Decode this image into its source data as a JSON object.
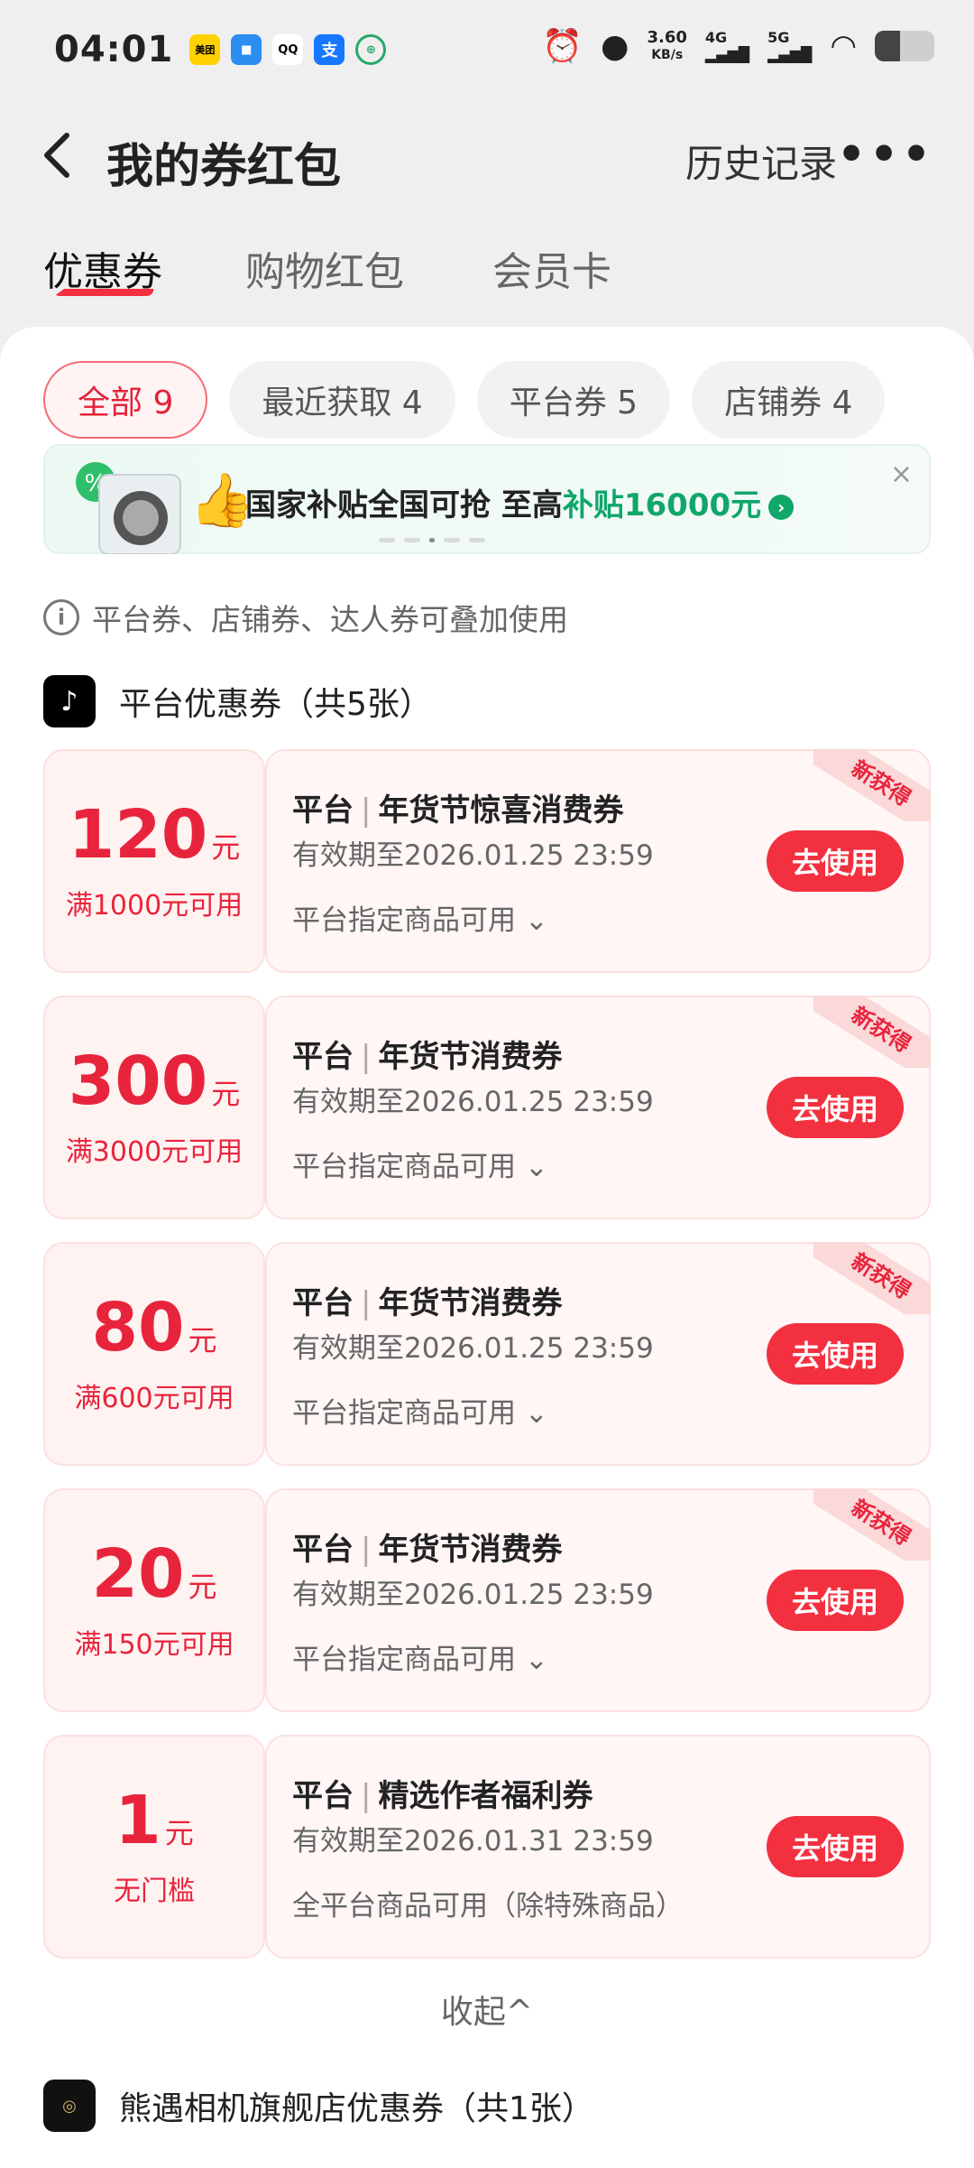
{
  "statusbar": {
    "time": "04:01",
    "apps": [
      "美团",
      "QQ",
      "支"
    ],
    "net_speed": "3.60",
    "net_unit": "KB/s",
    "sig1": "4G",
    "sig2": "5G"
  },
  "header": {
    "title": "我的券红包",
    "history": "历史记录",
    "more": "•••"
  },
  "tabs": [
    "优惠券",
    "购物红包",
    "会员卡"
  ],
  "chips": [
    "全部 9",
    "最近获取 4",
    "平台券 5",
    "店铺券 4"
  ],
  "banner": {
    "text_a": "国家补贴全国可抢 至高",
    "text_b": "补贴16000元",
    "close": "×"
  },
  "notice": "平台券、店铺券、达人券可叠加使用",
  "section1": "平台优惠券（共5张）",
  "coupons": [
    {
      "amount": "120",
      "unit": "元",
      "cond": "满1000元可用",
      "platform": "平台",
      "name": "年货节惊喜消费券",
      "valid": "有效期至2026.01.25 23:59",
      "scope": "平台指定商品可用",
      "tag": "新获得",
      "btn": "去使用"
    },
    {
      "amount": "300",
      "unit": "元",
      "cond": "满3000元可用",
      "platform": "平台",
      "name": "年货节消费券",
      "valid": "有效期至2026.01.25 23:59",
      "scope": "平台指定商品可用",
      "tag": "新获得",
      "btn": "去使用"
    },
    {
      "amount": "80",
      "unit": "元",
      "cond": "满600元可用",
      "platform": "平台",
      "name": "年货节消费券",
      "valid": "有效期至2026.01.25 23:59",
      "scope": "平台指定商品可用",
      "tag": "新获得",
      "btn": "去使用"
    },
    {
      "amount": "20",
      "unit": "元",
      "cond": "满150元可用",
      "platform": "平台",
      "name": "年货节消费券",
      "valid": "有效期至2026.01.25 23:59",
      "scope": "平台指定商品可用",
      "tag": "新获得",
      "btn": "去使用"
    },
    {
      "amount": "1",
      "unit": "元",
      "cond": "无门槛",
      "platform": "平台",
      "name": "精选作者福利券",
      "valid": "有效期至2026.01.31 23:59",
      "scope": "全平台商品可用（除特殊商品）",
      "tag": "",
      "btn": "去使用"
    }
  ],
  "collapse": "收起^",
  "section2": "熊遇相机旗舰店优惠券（共1张）",
  "colors": {
    "accent": "#f2303f",
    "green": "#11a66a"
  }
}
